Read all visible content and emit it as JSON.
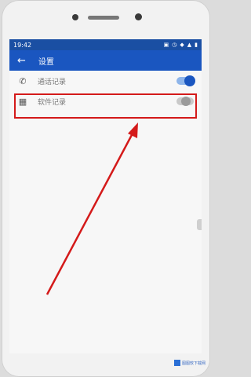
{
  "status": {
    "time": "19:42"
  },
  "appbar": {
    "title": "设置"
  },
  "rows": [
    {
      "label": "通话记录",
      "toggle": "on"
    },
    {
      "label": "软件记录",
      "toggle": "off"
    }
  ],
  "watermark": {
    "text": "图图软下载网"
  },
  "colors": {
    "accent": "#1a56c0",
    "highlight": "#d41a1a"
  }
}
